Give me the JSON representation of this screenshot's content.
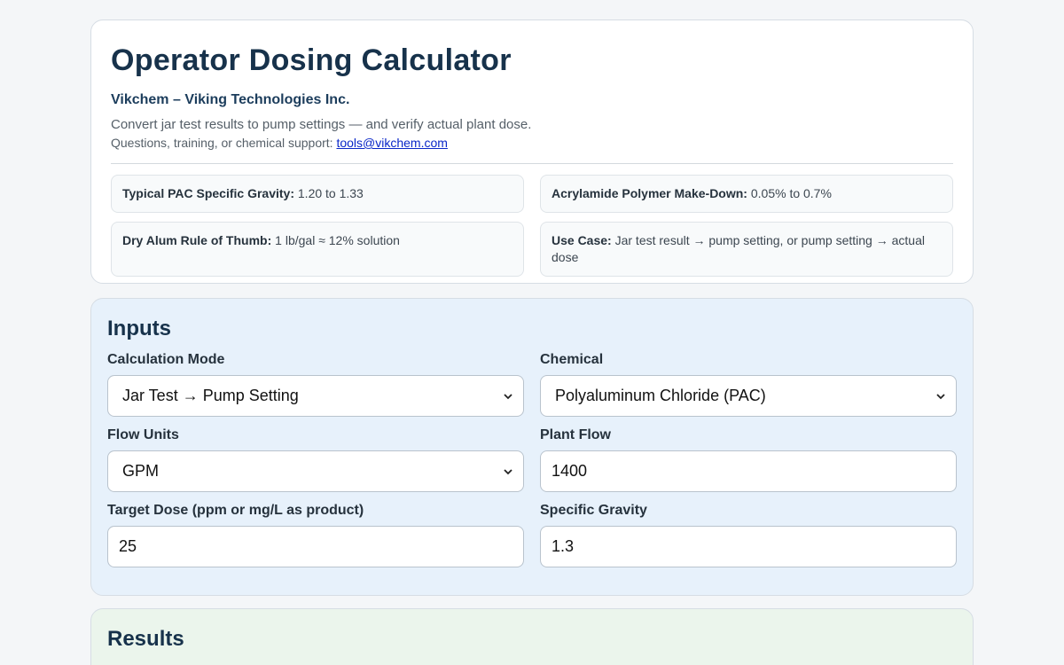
{
  "header": {
    "title": "Operator Dosing Calculator",
    "company": "Vikchem – Viking Technologies Inc.",
    "description": "Convert jar test results to pump settings — and verify actual plant dose.",
    "contact_prefix": "Questions, training, or chemical support:",
    "contact_email": "tools@vikchem.com"
  },
  "facts": [
    {
      "label": "Typical PAC Specific Gravity:",
      "value": "1.20 to 1.33"
    },
    {
      "label": "Acrylamide Polymer Make-Down:",
      "value": "0.05% to 0.7%"
    },
    {
      "label": "Dry Alum Rule of Thumb:",
      "value": "1 lb/gal ≈ 12% solution"
    },
    {
      "label": "Use Case:",
      "value": "Jar test result → pump setting, or pump setting → actual dose"
    }
  ],
  "inputs": {
    "title": "Inputs",
    "calc_mode": {
      "label": "Calculation Mode",
      "value": "Jar Test → Pump Setting"
    },
    "chemical": {
      "label": "Chemical",
      "value": "Polyaluminum Chloride (PAC)"
    },
    "flow_units": {
      "label": "Flow Units",
      "value": "GPM"
    },
    "plant_flow": {
      "label": "Plant Flow",
      "value": "1400"
    },
    "target_dose": {
      "label": "Target Dose (ppm or mg/L as product)",
      "value": "25"
    },
    "specific_gravity": {
      "label": "Specific Gravity",
      "value": "1.3"
    }
  },
  "results": {
    "title": "Results"
  }
}
